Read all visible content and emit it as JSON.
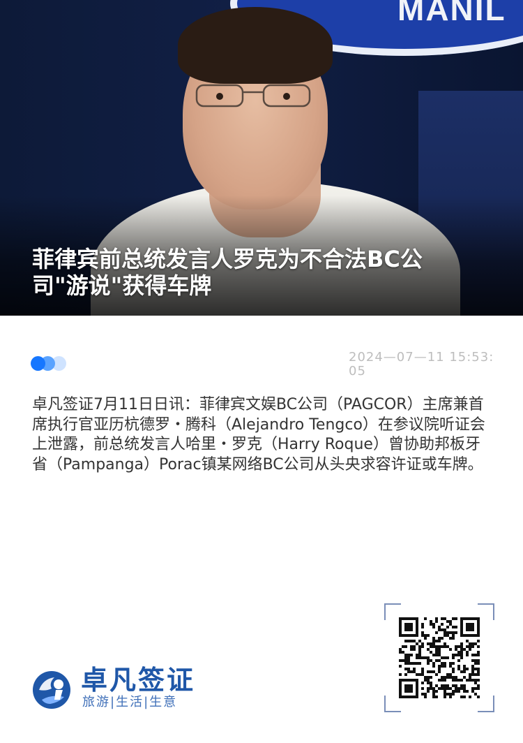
{
  "hero": {
    "title": "菲律宾前总统发言人罗克为不合法BC公司\"游说\"获得车牌",
    "banner_text": "MANIL"
  },
  "meta": {
    "date": "2024—07—11 15:53:05"
  },
  "article": {
    "body": "卓凡签证7月11日日讯：菲律宾文娱BC公司（PAGCOR）主席兼首席执行官亚历杭德罗・腾科（Alejandro Tengco）在参议院听证会上泄露，前总统发言人哈里・罗克（Harry Roque）曾协助邦板牙省（Pampanga）Porac镇某网络BC公司从头央求容许证或车牌。"
  },
  "footer": {
    "brand_name": "卓凡签证",
    "brand_tagline": "旅游|生活|生意"
  },
  "colors": {
    "accent": "#1677ff",
    "brand": "#1f57a8",
    "date_text": "#bdbdbd",
    "body_text": "#333333"
  }
}
